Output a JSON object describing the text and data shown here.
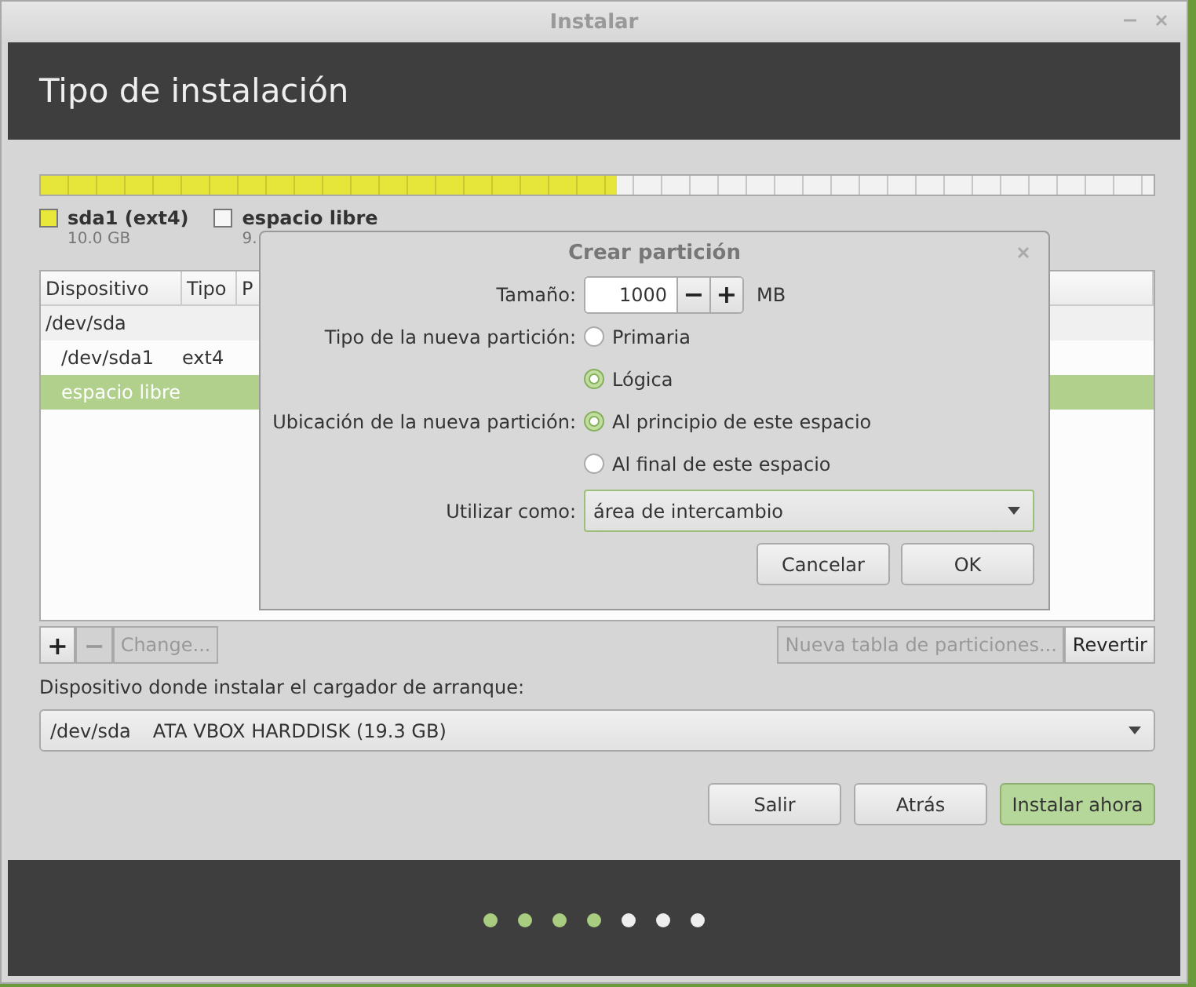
{
  "window": {
    "title": "Instalar"
  },
  "header": {
    "title": "Tipo de instalación"
  },
  "partition_bar": {
    "level": 0.517
  },
  "legend": [
    {
      "name": "sda1 (ext4)",
      "size": "10.0 GB",
      "color": "#e8e83a"
    },
    {
      "name": "espacio libre",
      "size": "9.",
      "color": "#f6f6f6"
    }
  ],
  "table": {
    "columns": [
      "Dispositivo",
      "Tipo",
      "P"
    ],
    "rows": [
      {
        "cells": [
          "/dev/sda"
        ],
        "selected": false,
        "children": [
          {
            "cells": [
              "/dev/sda1",
              "ext4"
            ],
            "selected": false
          },
          {
            "cells": [
              "espacio libre"
            ],
            "selected": true
          }
        ]
      }
    ]
  },
  "table_buttons": [
    {
      "label": "+",
      "disabled": false
    },
    {
      "label": "−",
      "disabled": true
    },
    {
      "label": "Change...",
      "disabled": true
    }
  ],
  "right_buttons": [
    {
      "label": "Nueva tabla de particiones...",
      "disabled": true
    },
    {
      "label": "Revertir",
      "disabled": false
    }
  ],
  "bootloader": {
    "label": "Dispositivo donde instalar el cargador de arranque:",
    "device": "/dev/sda",
    "description": "ATA VBOX HARDDISK (19.3 GB)"
  },
  "buttons": [
    {
      "label": "Salir",
      "default": false
    },
    {
      "label": "Atrás",
      "default": false
    },
    {
      "label": "Instalar ahora",
      "default": true
    }
  ],
  "steps": [
    {
      "done": true
    },
    {
      "done": true
    },
    {
      "done": true
    },
    {
      "done": true
    },
    {
      "done": false
    },
    {
      "done": false
    },
    {
      "done": false
    }
  ],
  "dialog": {
    "title": "Crear partición",
    "size_label": "Tamaño:",
    "size_value": "1000",
    "minus": "−",
    "plus": "+",
    "size_unit": "MB",
    "type_label": "Tipo de la nueva partición:",
    "type_options": [
      {
        "label": "Primaria",
        "selected": false
      },
      {
        "label": "Lógica",
        "selected": true
      }
    ],
    "location_label": "Ubicación de la nueva partición:",
    "location_options": [
      {
        "label": "Al principio de este espacio",
        "selected": true
      },
      {
        "label": "Al final de este espacio",
        "selected": false
      }
    ],
    "use_label": "Utilizar como:",
    "use_value": "área de intercambio",
    "buttons": [
      {
        "label": "Cancelar"
      },
      {
        "label": "OK"
      }
    ]
  }
}
